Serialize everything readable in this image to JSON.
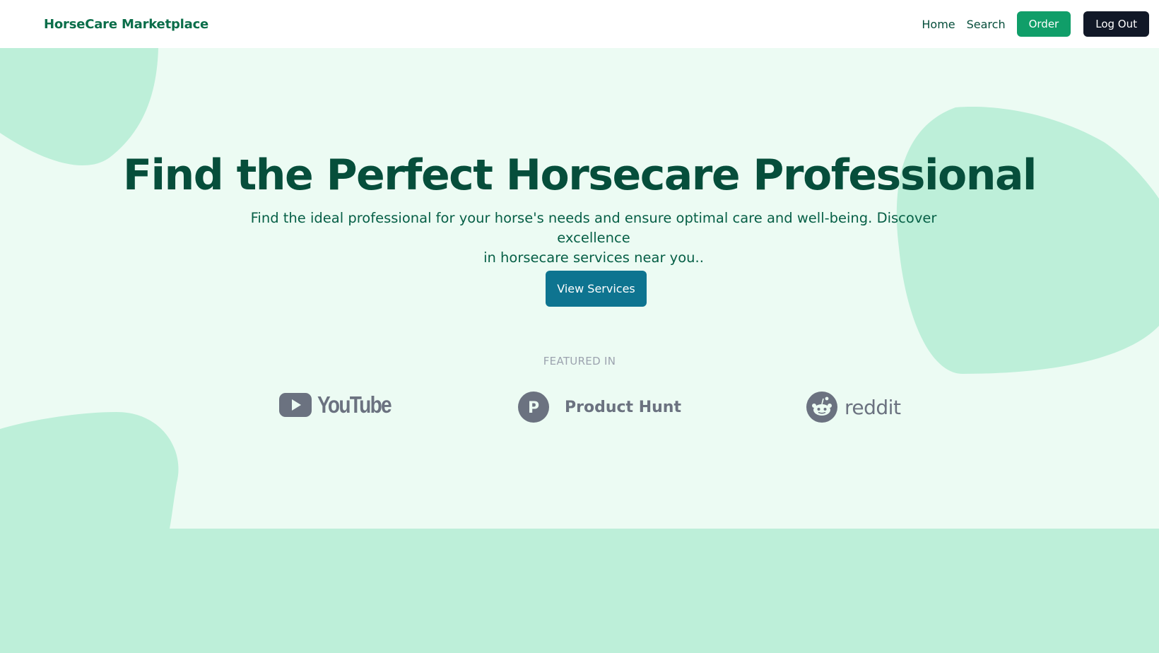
{
  "navbar": {
    "brand": "HorseCare Marketplace",
    "links": [
      "Home",
      "Search"
    ],
    "order_label": "Order",
    "logout_label": "Log Out"
  },
  "hero": {
    "title": "Find the Perfect Horsecare Professional",
    "subtitle_line1": "Find the ideal professional for your horse's needs and ensure optimal care and well-being. Discover excellence",
    "subtitle_line2": "in horsecare services near you..",
    "cta_label": "View Services"
  },
  "featured": {
    "label": "FEATURED IN",
    "logos": [
      {
        "name": "YouTube",
        "text": "YouTube",
        "icon": "youtube-play-icon"
      },
      {
        "name": "Product Hunt",
        "text": "Product Hunt",
        "icon": "product-hunt-p-icon"
      },
      {
        "name": "reddit",
        "text": "reddit",
        "icon": "reddit-alien-icon"
      }
    ]
  },
  "colors": {
    "brand_green": "#0b6e4a",
    "order_button": "#109e69",
    "logout_button": "#111827",
    "cta_button": "#0e7490",
    "hero_bg": "#ecfbf3",
    "blob": "#bdefd9",
    "logo_gray": "#6b7280"
  }
}
